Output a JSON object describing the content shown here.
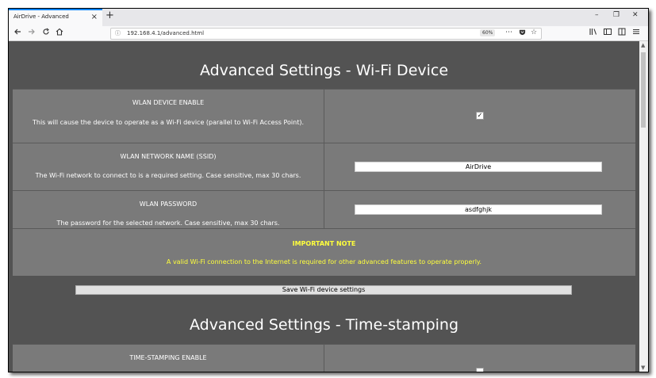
{
  "browser": {
    "tab_title": "AirDrive - Advanced",
    "tab_close": "×",
    "new_tab": "+",
    "win_min": "–",
    "win_max": "❐",
    "win_close": "✕",
    "url": "192.168.4.1/advanced.html",
    "zoom": "60%",
    "icons": [
      "back-icon",
      "forward-icon",
      "reload-icon",
      "home-icon",
      "info-icon",
      "page-actions-icon",
      "pocket-icon",
      "bookmark-star-icon",
      "library-icon",
      "sidebar-icon",
      "reader-icon",
      "menu-icon"
    ]
  },
  "section1": {
    "title": "Advanced Settings - Wi-Fi Device",
    "enable": {
      "label": "WLAN DEVICE ENABLE",
      "desc": "This will cause the device to operate as a Wi-Fi device (parallel to Wi-Fi Access Point).",
      "checked": true,
      "check_mark": "✓"
    },
    "ssid": {
      "label": "WLAN NETWORK NAME (SSID)",
      "desc": "The Wi-Fi network to connect to is a required setting. Case sensitive, max 30 chars.",
      "value": "AirDrive"
    },
    "password": {
      "label": "WLAN PASSWORD",
      "desc": "The password for the selected network. Case sensitive, max 30 chars.",
      "value": "asdfghjk"
    },
    "note": {
      "title": "IMPORTANT NOTE",
      "text": "A valid Wi-Fi connection to the Internet is required for other advanced features to operate properly."
    },
    "save_label": "Save Wi-Fi device settings"
  },
  "section2": {
    "title": "Advanced Settings - Time-stamping",
    "enable": {
      "label": "TIME-STAMPING ENABLE",
      "checked": false
    }
  },
  "colors": {
    "page_bg": "#535353",
    "row_bg": "#7a7a7a",
    "note_text": "#ffff3c",
    "tab_accent": "#0a84ff"
  }
}
